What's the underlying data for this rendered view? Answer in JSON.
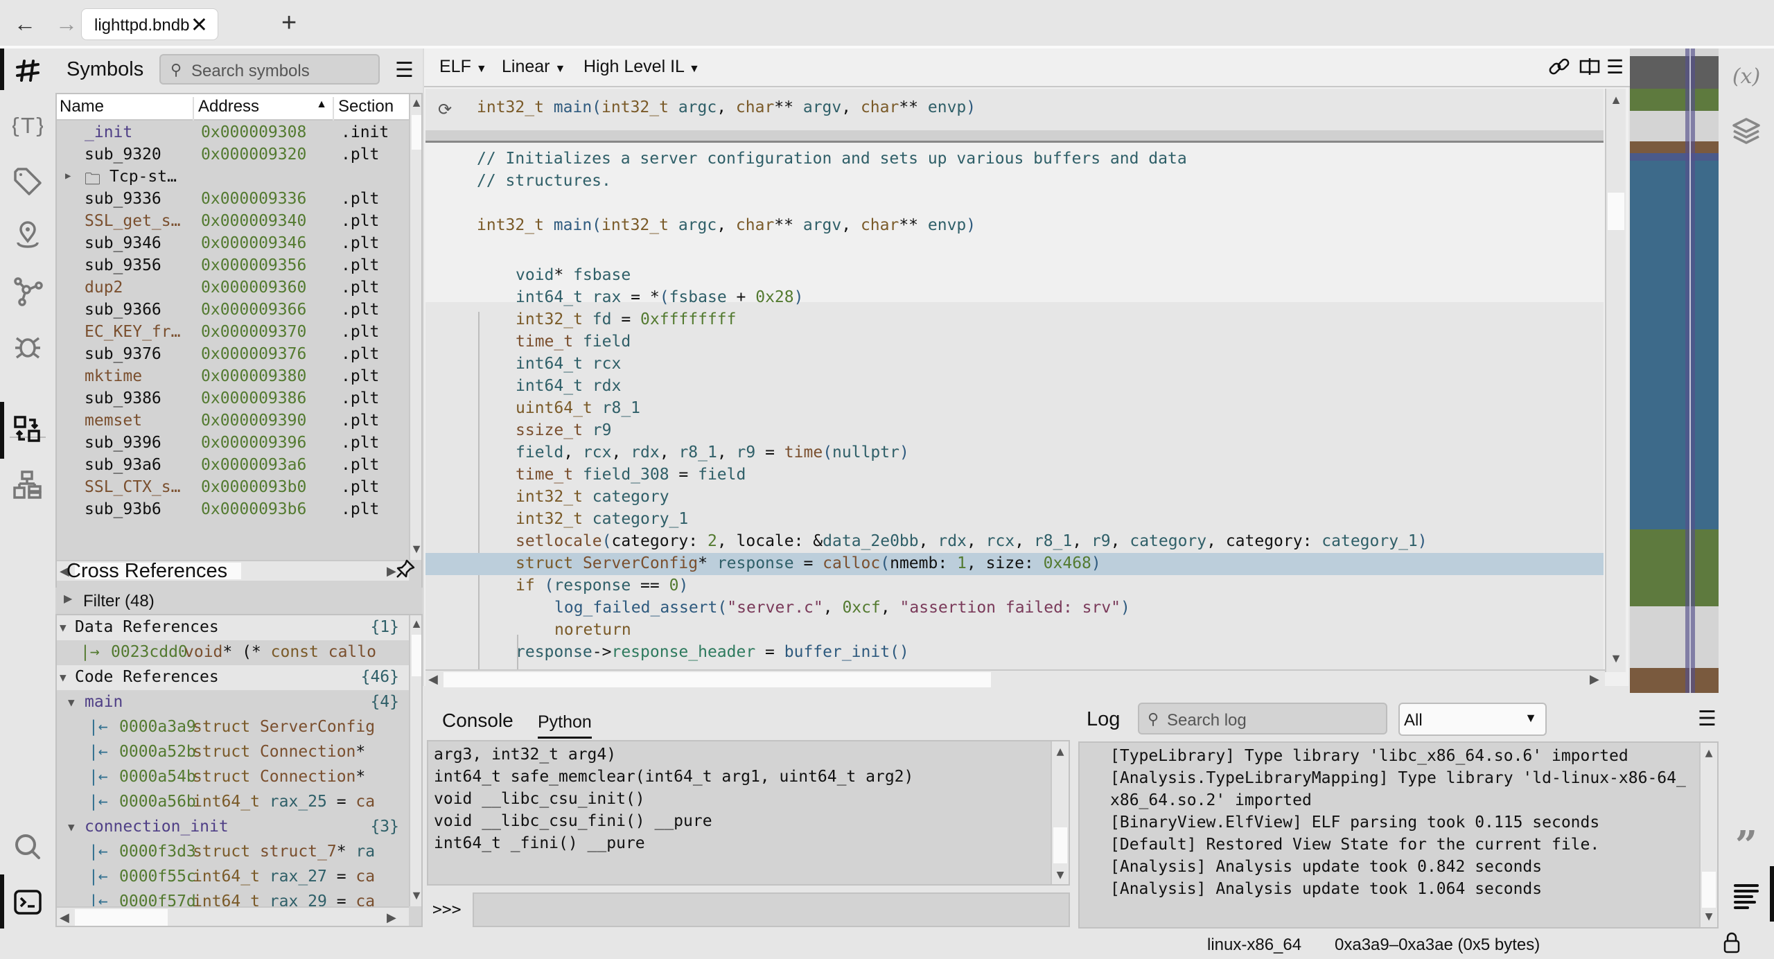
{
  "titlebar": {
    "back_icon": "arrow-left-icon",
    "forward_icon": "arrow-right-icon",
    "tab_label": "lighttpd.bndb",
    "tab_close": "✕",
    "new_tab": "+"
  },
  "left_rail": {
    "items": [
      {
        "name": "symbols",
        "icon": "hash-icon",
        "active": true
      },
      {
        "name": "types",
        "icon": "type-braces-icon",
        "active": false
      },
      {
        "name": "tags",
        "icon": "tag-icon",
        "active": false
      },
      {
        "name": "bookmarks",
        "icon": "location-pin-icon",
        "active": false
      },
      {
        "name": "graph",
        "icon": "graph-nodes-icon",
        "active": false
      },
      {
        "name": "debugger",
        "icon": "bug-icon",
        "active": false
      },
      {
        "name": "cross-references",
        "icon": "xref-swap-icon",
        "active": true
      },
      {
        "name": "hierarchy",
        "icon": "hierarchy-icon",
        "active": false
      },
      {
        "name": "search",
        "icon": "search-icon",
        "active": false
      },
      {
        "name": "console",
        "icon": "terminal-icon",
        "active": true
      }
    ]
  },
  "symbols": {
    "title": "Symbols",
    "search_placeholder": "Search symbols",
    "columns": [
      "Name",
      "Address",
      "Section"
    ],
    "sort_column": "Address",
    "rows": [
      {
        "name": "_init",
        "address": "0x000009308",
        "section": ".init",
        "kind": "sym"
      },
      {
        "name": "sub_9320",
        "address": "0x000009320",
        "section": ".plt",
        "kind": "func"
      },
      {
        "name": "Tcp-st…",
        "address": "",
        "section": "",
        "kind": "folder"
      },
      {
        "name": "sub_9336",
        "address": "0x000009336",
        "section": ".plt",
        "kind": "func"
      },
      {
        "name": "SSL_get_s…",
        "address": "0x000009340",
        "section": ".plt",
        "kind": "imp"
      },
      {
        "name": "sub_9346",
        "address": "0x000009346",
        "section": ".plt",
        "kind": "func"
      },
      {
        "name": "sub_9356",
        "address": "0x000009356",
        "section": ".plt",
        "kind": "func"
      },
      {
        "name": "dup2",
        "address": "0x000009360",
        "section": ".plt",
        "kind": "imp"
      },
      {
        "name": "sub_9366",
        "address": "0x000009366",
        "section": ".plt",
        "kind": "func"
      },
      {
        "name": "EC_KEY_fr…",
        "address": "0x000009370",
        "section": ".plt",
        "kind": "imp"
      },
      {
        "name": "sub_9376",
        "address": "0x000009376",
        "section": ".plt",
        "kind": "func"
      },
      {
        "name": "mktime",
        "address": "0x000009380",
        "section": ".plt",
        "kind": "imp"
      },
      {
        "name": "sub_9386",
        "address": "0x000009386",
        "section": ".plt",
        "kind": "func"
      },
      {
        "name": "memset",
        "address": "0x000009390",
        "section": ".plt",
        "kind": "imp"
      },
      {
        "name": "sub_9396",
        "address": "0x000009396",
        "section": ".plt",
        "kind": "func"
      },
      {
        "name": "sub_93a6",
        "address": "0x0000093a6",
        "section": ".plt",
        "kind": "func"
      },
      {
        "name": "SSL_CTX_s…",
        "address": "0x0000093b0",
        "section": ".plt",
        "kind": "imp"
      },
      {
        "name": "sub_93b6",
        "address": "0x0000093b6",
        "section": ".plt",
        "kind": "func"
      }
    ]
  },
  "xrefs": {
    "title": "Cross References",
    "filter_label": "Filter (48)",
    "groups": [
      {
        "label": "Data References",
        "count": "{1}",
        "items": [
          {
            "address": "0023cdd0",
            "parts": [
              [
                "xr-type",
                "void"
              ],
              [
                "d",
                "* (* "
              ],
              [
                "xr-kw",
                "const "
              ],
              [
                "xr-type",
                "callo"
              ]
            ]
          }
        ]
      },
      {
        "label": "Code References",
        "count": "{46}",
        "subgroups": [
          {
            "label": "main",
            "count": "{4}",
            "items": [
              {
                "address": "0000a3a9",
                "parts": [
                  [
                    "xr-kw",
                    "struct "
                  ],
                  [
                    "xr-type",
                    "ServerConfig"
                  ]
                ]
              },
              {
                "address": "0000a52b",
                "parts": [
                  [
                    "xr-kw",
                    "struct "
                  ],
                  [
                    "xr-type",
                    "Connection"
                  ],
                  [
                    "d",
                    "*"
                  ]
                ]
              },
              {
                "address": "0000a54b",
                "parts": [
                  [
                    "xr-kw",
                    "struct "
                  ],
                  [
                    "xr-type",
                    "Connection"
                  ],
                  [
                    "d",
                    "*"
                  ]
                ]
              },
              {
                "address": "0000a56b",
                "parts": [
                  [
                    "xr-kw",
                    "int64_t "
                  ],
                  [
                    "xr-var",
                    "rax_25"
                  ],
                  [
                    "d",
                    " = "
                  ],
                  [
                    "xr-type",
                    "ca"
                  ]
                ]
              }
            ]
          },
          {
            "label": "connection_init",
            "count": "{3}",
            "items": [
              {
                "address": "0000f3d3",
                "parts": [
                  [
                    "xr-kw",
                    "struct "
                  ],
                  [
                    "xr-type",
                    "struct_7"
                  ],
                  [
                    "d",
                    "* "
                  ],
                  [
                    "xr-var",
                    "ra"
                  ]
                ]
              },
              {
                "address": "0000f55c",
                "parts": [
                  [
                    "xr-kw",
                    "int64_t "
                  ],
                  [
                    "xr-var",
                    "rax_27"
                  ],
                  [
                    "d",
                    " = "
                  ],
                  [
                    "xr-type",
                    "ca"
                  ]
                ]
              },
              {
                "address": "0000f57d",
                "parts": [
                  [
                    "xr-kw",
                    "int64_t "
                  ],
                  [
                    "xr-var",
                    "rax_29"
                  ],
                  [
                    "d",
                    " = "
                  ],
                  [
                    "xr-type",
                    "ca"
                  ]
                ]
              }
            ]
          }
        ]
      }
    ]
  },
  "view_toolbar": {
    "view_type": "ELF",
    "layout": "Linear",
    "il_level": "High Level IL",
    "icons": [
      "link-icon",
      "split-view-icon",
      "menu-icon"
    ]
  },
  "code": {
    "sticky_header": [
      [
        "k",
        "int32_t "
      ],
      [
        "f",
        "main"
      ],
      [
        "p",
        "("
      ],
      [
        "k",
        "int32_t "
      ],
      [
        "v",
        "argc"
      ],
      [
        "d",
        ", "
      ],
      [
        "k",
        "char"
      ],
      [
        "d",
        "** "
      ],
      [
        "v",
        "argv"
      ],
      [
        "d",
        ", "
      ],
      [
        "k",
        "char"
      ],
      [
        "d",
        "** "
      ],
      [
        "v",
        "envp"
      ],
      [
        "p",
        ")"
      ]
    ],
    "lines": [
      {
        "indent": 0,
        "parts": [
          [
            "cm",
            "// Initializes a server configuration and sets up various buffers and data"
          ]
        ]
      },
      {
        "indent": 0,
        "parts": [
          [
            "cm",
            "// structures."
          ]
        ]
      },
      {
        "indent": 0,
        "parts": []
      },
      {
        "indent": 0,
        "parts": [
          [
            "k",
            "int32_t "
          ],
          [
            "f",
            "main"
          ],
          [
            "p",
            "("
          ],
          [
            "k",
            "int32_t "
          ],
          [
            "v",
            "argc"
          ],
          [
            "d",
            ", "
          ],
          [
            "k",
            "char"
          ],
          [
            "d",
            "** "
          ],
          [
            "v",
            "argv"
          ],
          [
            "d",
            ", "
          ],
          [
            "k",
            "char"
          ],
          [
            "d",
            "** "
          ],
          [
            "v",
            "envp"
          ],
          [
            "p",
            ")"
          ]
        ]
      },
      {
        "indent": 0,
        "parts": []
      },
      {
        "indent": 1,
        "parts": [
          [
            "v",
            "void"
          ],
          [
            "d",
            "* "
          ],
          [
            "v",
            "fsbase"
          ]
        ]
      },
      {
        "indent": 1,
        "parts": [
          [
            "v",
            "int64_t "
          ],
          [
            "v",
            "rax"
          ],
          [
            "d",
            " = *"
          ],
          [
            "p",
            "("
          ],
          [
            "v",
            "fsbase"
          ],
          [
            "d",
            " + "
          ],
          [
            "n",
            "0x28"
          ],
          [
            "p",
            ")"
          ]
        ]
      },
      {
        "indent": 1,
        "parts": [
          [
            "k",
            "int32_t "
          ],
          [
            "v",
            "fd"
          ],
          [
            "d",
            " = "
          ],
          [
            "n",
            "0xffffffff"
          ]
        ]
      },
      {
        "indent": 1,
        "parts": [
          [
            "t",
            "time_t "
          ],
          [
            "v",
            "field"
          ]
        ]
      },
      {
        "indent": 1,
        "parts": [
          [
            "v",
            "int64_t "
          ],
          [
            "v",
            "rcx"
          ]
        ]
      },
      {
        "indent": 1,
        "parts": [
          [
            "v",
            "int64_t "
          ],
          [
            "v",
            "rdx"
          ]
        ]
      },
      {
        "indent": 1,
        "parts": [
          [
            "k",
            "uint64_t "
          ],
          [
            "v",
            "r8_1"
          ]
        ]
      },
      {
        "indent": 1,
        "parts": [
          [
            "t",
            "ssize_t "
          ],
          [
            "v",
            "r9"
          ]
        ]
      },
      {
        "indent": 1,
        "parts": [
          [
            "v",
            "field"
          ],
          [
            "d",
            ", "
          ],
          [
            "v",
            "rcx"
          ],
          [
            "d",
            ", "
          ],
          [
            "v",
            "rdx"
          ],
          [
            "d",
            ", "
          ],
          [
            "v",
            "r8_1"
          ],
          [
            "d",
            ", "
          ],
          [
            "v",
            "r9"
          ],
          [
            "d",
            " = "
          ],
          [
            "t",
            "time"
          ],
          [
            "p",
            "("
          ],
          [
            "v",
            "nullptr"
          ],
          [
            "p",
            ")"
          ]
        ]
      },
      {
        "indent": 1,
        "parts": [
          [
            "t",
            "time_t "
          ],
          [
            "v",
            "field_308"
          ],
          [
            "d",
            " = "
          ],
          [
            "v",
            "field"
          ]
        ]
      },
      {
        "indent": 1,
        "parts": [
          [
            "k",
            "int32_t "
          ],
          [
            "v",
            "category"
          ]
        ]
      },
      {
        "indent": 1,
        "parts": [
          [
            "k",
            "int32_t "
          ],
          [
            "v",
            "category_1"
          ]
        ]
      },
      {
        "indent": 1,
        "parts": [
          [
            "t",
            "setlocale"
          ],
          [
            "p",
            "("
          ],
          [
            "d",
            "category: "
          ],
          [
            "n",
            "2"
          ],
          [
            "d",
            ", locale: &"
          ],
          [
            "v",
            "data_2e0bb"
          ],
          [
            "d",
            ", "
          ],
          [
            "v",
            "rdx"
          ],
          [
            "d",
            ", "
          ],
          [
            "v",
            "rcx"
          ],
          [
            "d",
            ", "
          ],
          [
            "v",
            "r8_1"
          ],
          [
            "d",
            ", "
          ],
          [
            "v",
            "r9"
          ],
          [
            "d",
            ", "
          ],
          [
            "v",
            "category"
          ],
          [
            "d",
            ", category: "
          ],
          [
            "v",
            "category_1"
          ],
          [
            "p",
            ")"
          ]
        ]
      },
      {
        "indent": 1,
        "highlight": true,
        "parts": [
          [
            "k",
            "struct "
          ],
          [
            "t",
            "ServerConfig"
          ],
          [
            "d",
            "* "
          ],
          [
            "v",
            "response"
          ],
          [
            "d",
            " = "
          ],
          [
            "t",
            "calloc"
          ],
          [
            "p",
            "("
          ],
          [
            "d",
            "nmemb: "
          ],
          [
            "n",
            "1"
          ],
          [
            "d",
            ", size: "
          ],
          [
            "n",
            "0x468"
          ],
          [
            "p",
            ")"
          ]
        ]
      },
      {
        "indent": 1,
        "parts": [
          [
            "k",
            "if "
          ],
          [
            "p",
            "("
          ],
          [
            "v",
            "response"
          ],
          [
            "d",
            " == "
          ],
          [
            "n",
            "0"
          ],
          [
            "p",
            ")"
          ]
        ]
      },
      {
        "indent": 2,
        "parts": [
          [
            "f",
            "log_failed_assert"
          ],
          [
            "p",
            "("
          ],
          [
            "s",
            "\"server.c\""
          ],
          [
            "d",
            ", "
          ],
          [
            "n",
            "0xcf"
          ],
          [
            "d",
            ", "
          ],
          [
            "s",
            "\"assertion failed: srv\""
          ],
          [
            "p",
            ")"
          ]
        ]
      },
      {
        "indent": 2,
        "parts": [
          [
            "k",
            "noreturn"
          ]
        ]
      },
      {
        "indent": 1,
        "parts": [
          [
            "v",
            "response"
          ],
          [
            "d",
            "->"
          ],
          [
            "fld",
            "response_header"
          ],
          [
            "d",
            " = "
          ],
          [
            "f",
            "buffer_init"
          ],
          [
            "p",
            "()"
          ]
        ]
      }
    ]
  },
  "minimap": {
    "blocks": [
      {
        "color": "#d4d4d4",
        "span": 0.012
      },
      {
        "color": "#5e5e5e",
        "span": 0.05
      },
      {
        "color": "#5e7a3e",
        "span": 0.035
      },
      {
        "color": "#d4d4d4",
        "span": 0.047
      },
      {
        "color": "#7a5a3e",
        "span": 0.018
      },
      {
        "color": "#4a5a8a",
        "span": 0.012
      },
      {
        "color": "#3d6a8a",
        "span": 0.572
      },
      {
        "color": "#5e7a3e",
        "span": 0.12
      },
      {
        "color": "#d4d4d4",
        "span": 0.095
      },
      {
        "color": "#7a5a3e",
        "span": 0.039
      }
    ]
  },
  "right_rail": {
    "items": [
      {
        "name": "variables",
        "icon": "variables-icon",
        "label": "(x)"
      },
      {
        "name": "layers",
        "icon": "layers-icon"
      },
      {
        "name": "comments",
        "icon": "quote-icon"
      },
      {
        "name": "log-panel",
        "icon": "text-lines-icon",
        "active": true
      }
    ]
  },
  "console": {
    "tabs": [
      "Console",
      "Python"
    ],
    "active_tab": "Python",
    "output": [
      "arg3, int32_t arg4)",
      "int64_t safe_memclear(int64_t arg1, uint64_t arg2)",
      "void __libc_csu_init()",
      "void __libc_csu_fini() __pure",
      "int64_t _fini() __pure"
    ],
    "prompt": ">>>",
    "input_value": ""
  },
  "log": {
    "title": "Log",
    "search_placeholder": "Search log",
    "level_selected": "All",
    "lines": [
      "[TypeLibrary] Type library 'libc_x86_64.so.6' imported",
      "[Analysis.TypeLibraryMapping] Type library 'ld-linux-x86-64_",
      "x86_64.so.2' imported",
      "[BinaryView.ElfView] ELF parsing took 0.115 seconds",
      "[Default] Restored View State for the current file.",
      "[Analysis] Analysis update took 0.842 seconds",
      "[Analysis] Analysis update took 1.064 seconds"
    ]
  },
  "statusbar": {
    "platform": "linux-x86_64",
    "selection": "0xa3a9–0xa3ae (0x5 bytes)",
    "lock_icon": "lock-icon"
  }
}
